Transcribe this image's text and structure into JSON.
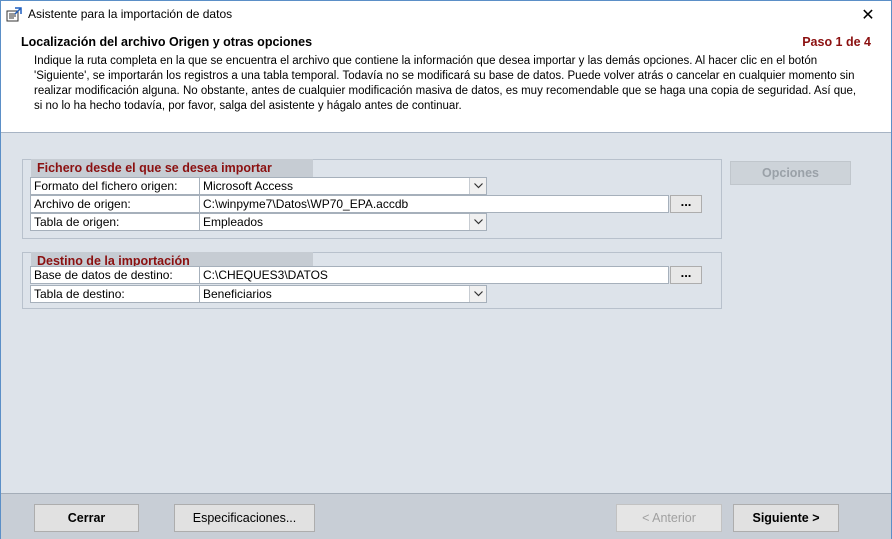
{
  "window": {
    "title": "Asistente para la importación de datos",
    "close_symbol": "✕"
  },
  "header": {
    "title": "Localización del archivo Origen y otras opciones",
    "step": "Paso 1 de 4",
    "description": "Indique la ruta completa en la que se encuentra el archivo que contiene la información que desea importar y las demás opciones. Al hacer clic en el botón 'Siguiente', se importarán los registros a una tabla temporal. Todavía no se modificará su base de datos. Puede volver atrás o cancelar en cualquier momento sin realizar modificación alguna. No obstante, antes de cualquier modificación masiva de datos, es muy recomendable que se haga una copia de seguridad. Así que, si no lo ha hecho todavía, por favor, salga del asistente y hágalo antes de continuar."
  },
  "source_group": {
    "title": "Fichero desde el que se desea importar",
    "format_label": "Formato del fichero origen:",
    "format_value": "Microsoft Access",
    "file_label": "Archivo de origen:",
    "file_value": "C:\\winpyme7\\Datos\\WP70_EPA.accdb",
    "table_label": "Tabla de origen:",
    "table_value": "Empleados",
    "browse_label": "..."
  },
  "options_button": "Opciones",
  "dest_group": {
    "title": "Destino de la importación",
    "db_label": "Base de datos de destino:",
    "db_value": "C:\\CHEQUES3\\DATOS",
    "table_label": "Tabla de destino:",
    "table_value": "Beneficiarios",
    "browse_label": "..."
  },
  "footer": {
    "close": "Cerrar",
    "specs": "Especificaciones...",
    "previous": "< Anterior",
    "next": "Siguiente >"
  },
  "icons": {
    "app": "import-wizard-icon",
    "dropdown": "chevron-down-icon"
  }
}
